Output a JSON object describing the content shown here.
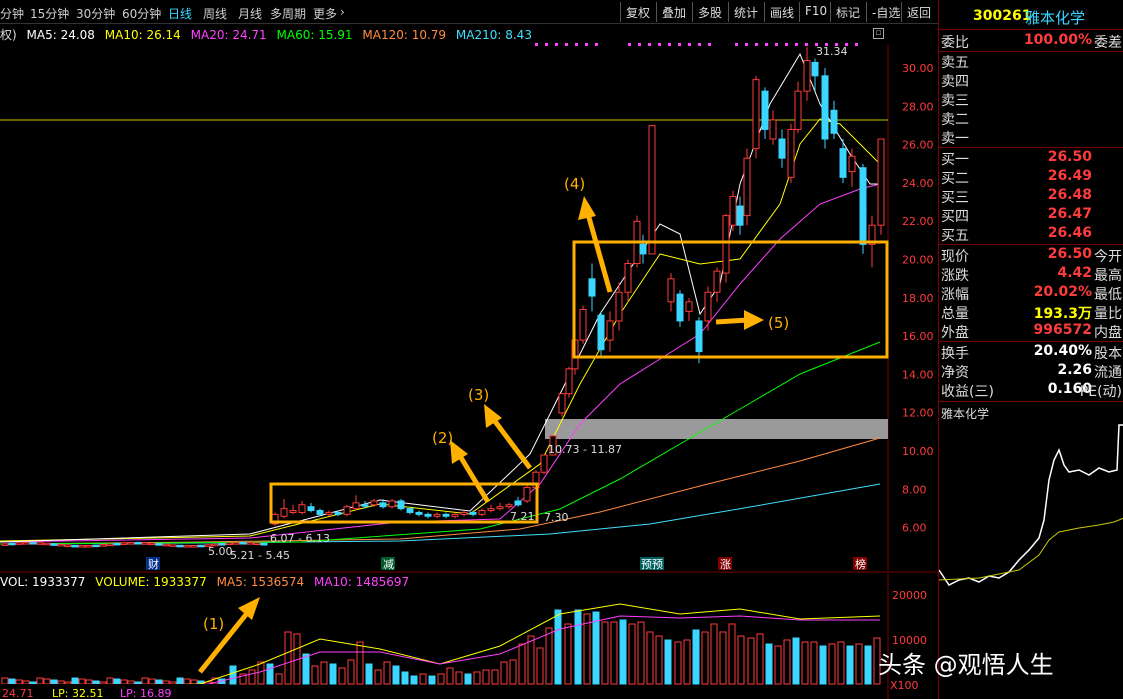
{
  "toolbar": {
    "timeframes": [
      "分钟",
      "15分钟",
      "30分钟",
      "60分钟",
      "日线",
      "周线",
      "月线",
      "多周期",
      "更多"
    ],
    "active": "日线",
    "buttons": [
      "复权",
      "叠加",
      "多股",
      "统计",
      "画线",
      "F10",
      "标记",
      "-自选",
      "返回"
    ]
  },
  "ma_line": {
    "prefix": "权)",
    "items": [
      {
        "label": "MA5: 24.08",
        "color": "#ffffff"
      },
      {
        "label": "MA10: 26.14",
        "color": "#ffff00"
      },
      {
        "label": "MA20: 24.71",
        "color": "#ff40ff"
      },
      {
        "label": "MA60: 15.91",
        "color": "#00ff00"
      },
      {
        "label": "MA120: 10.79",
        "color": "#ff8c40"
      },
      {
        "label": "MA210: 8.43",
        "color": "#40e0ff"
      }
    ]
  },
  "price_axis": [
    "30.00",
    "28.00",
    "26.00",
    "24.00",
    "22.00",
    "20.00",
    "18.00",
    "16.00",
    "14.00",
    "12.00",
    "10.00",
    "8.00",
    "6.00"
  ],
  "annotations": {
    "high_label": "31.34",
    "gap_label": "10.73 - 11.87",
    "low_labels": [
      "5.00",
      "5.21 - 5.45",
      "6.07 - 6.13",
      "7.21",
      "7.30"
    ],
    "markers": [
      "(1)",
      "(2)",
      "(3)",
      "(4)",
      "(5)"
    ]
  },
  "event_tags": [
    "财",
    "减",
    "预预",
    "涨",
    "榜"
  ],
  "volume": {
    "header": [
      {
        "label": "VOL: 1933377",
        "color": "#ffffff"
      },
      {
        "label": "VOLUME: 1933377",
        "color": "#ffff00"
      },
      {
        "label": "MA5: 1536574",
        "color": "#ff8c40"
      },
      {
        "label": "MA10: 1485697",
        "color": "#ff40ff"
      }
    ],
    "axis": [
      "20000",
      "10000"
    ],
    "unit": "X100",
    "footer": [
      "24.71",
      "LP: 32.51",
      "LP: 16.89"
    ]
  },
  "quote": {
    "code": "300261",
    "name": "雅本化学",
    "weibi_label": "委比",
    "weibi_value": "100.00%",
    "weicha_label": "委差",
    "sell": [
      {
        "label": "卖五",
        "price": ""
      },
      {
        "label": "卖四",
        "price": ""
      },
      {
        "label": "卖三",
        "price": ""
      },
      {
        "label": "卖二",
        "price": ""
      },
      {
        "label": "卖一",
        "price": ""
      }
    ],
    "buy": [
      {
        "label": "买一",
        "price": "26.50"
      },
      {
        "label": "买二",
        "price": "26.49"
      },
      {
        "label": "买三",
        "price": "26.48"
      },
      {
        "label": "买四",
        "price": "26.47"
      },
      {
        "label": "买五",
        "price": "26.46"
      }
    ],
    "stats": [
      {
        "label": "现价",
        "value": "26.50",
        "label2": "今开",
        "cls": "red"
      },
      {
        "label": "涨跌",
        "value": "4.42",
        "label2": "最高",
        "cls": "red"
      },
      {
        "label": "涨幅",
        "value": "20.02%",
        "label2": "最低",
        "cls": "red"
      },
      {
        "label": "总量",
        "value": "193.3万",
        "label2": "量比",
        "cls": "yel"
      },
      {
        "label": "外盘",
        "value": "996572",
        "label2": "内盘",
        "cls": "red"
      }
    ],
    "stats2": [
      {
        "label": "换手",
        "value": "20.40%",
        "label2": "股本"
      },
      {
        "label": "净资",
        "value": "2.26",
        "label2": "流通"
      },
      {
        "label": "收益(三)",
        "value": "0.160",
        "label2": "PE(动)"
      }
    ],
    "mini_title": "雅本化学"
  },
  "watermark": "头条 @观悟人生",
  "colors": {
    "up": "#ff3b3b",
    "down": "#3ad6ff",
    "box": "#ffb000"
  }
}
